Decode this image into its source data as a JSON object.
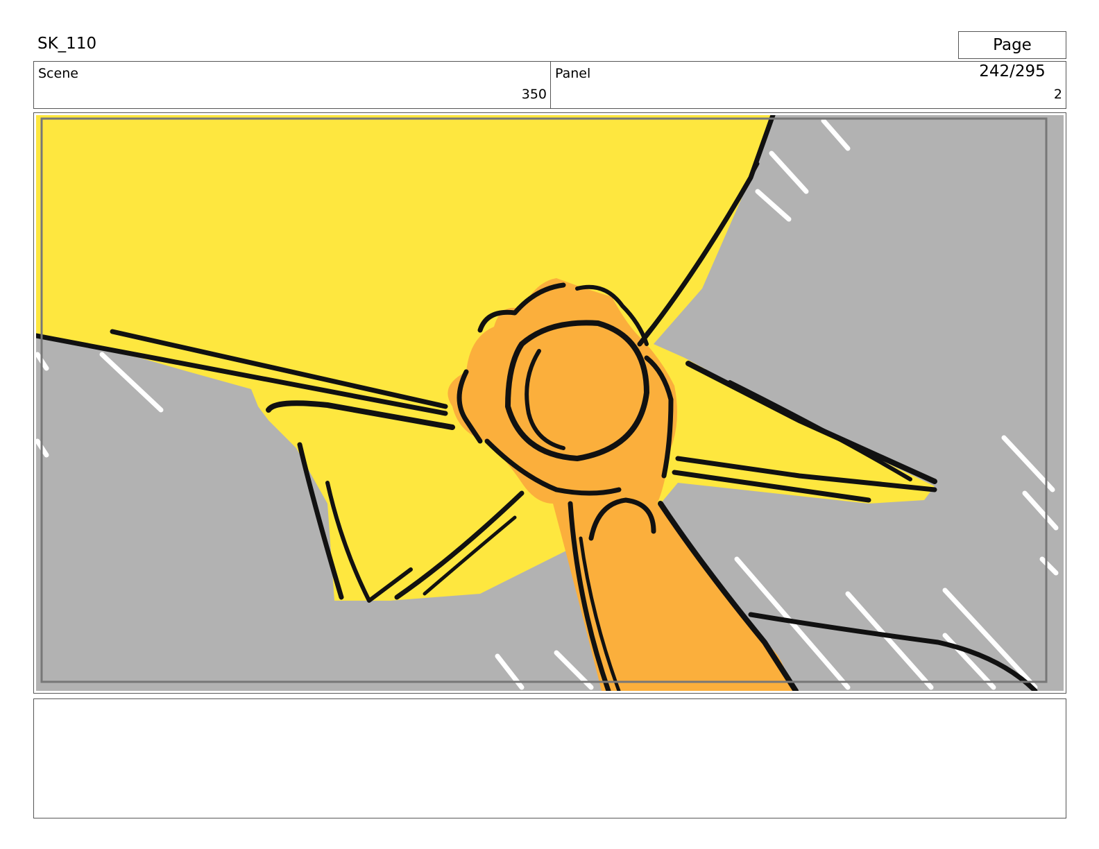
{
  "header": {
    "title": "SK_110",
    "page": "Page 242/295"
  },
  "info": {
    "scene_label": "Scene",
    "scene_value": "350",
    "panel_label": "Panel",
    "panel_value": "2"
  },
  "artwork": {
    "colors": {
      "sky": "#b2b2b2",
      "explosion": "#fee73f",
      "arm": "#fbaf3c",
      "ink": "#111111",
      "rain": "#ffffff"
    }
  },
  "notes": {
    "text": ""
  }
}
